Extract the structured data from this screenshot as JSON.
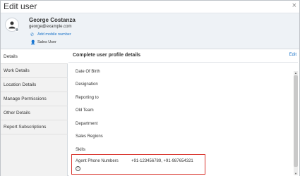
{
  "window": {
    "title": "Edit user",
    "close_glyph": "×"
  },
  "user": {
    "name": "George Costanza",
    "email": "george@example.com",
    "add_mobile_label": "Add mobile number",
    "role": "Sales User",
    "avatar_icon": "user-avatar-icon"
  },
  "sidebar": {
    "items": [
      {
        "label": "Details"
      },
      {
        "label": "Work Details"
      },
      {
        "label": "Location Details"
      },
      {
        "label": "Manage Permissions"
      },
      {
        "label": "Other Details"
      },
      {
        "label": "Report Subscriptions"
      }
    ]
  },
  "main": {
    "title": "Complete user profile details",
    "edit_label": "Edit",
    "fields": [
      {
        "label": "Date Of Birth"
      },
      {
        "label": "Designation"
      },
      {
        "label": "Reporting to"
      },
      {
        "label": "Old Team"
      },
      {
        "label": "Department"
      },
      {
        "label": "Sales Regions"
      },
      {
        "label": "Skills"
      }
    ],
    "highlighted_field": {
      "label": "Agent Phone Numbers",
      "value": "+91-123456789, +91-987654321",
      "info_glyph": "i"
    }
  },
  "colors": {
    "accent": "#1a73c8",
    "highlight_border": "#d9352e",
    "header_bg": "#eef2f6"
  }
}
